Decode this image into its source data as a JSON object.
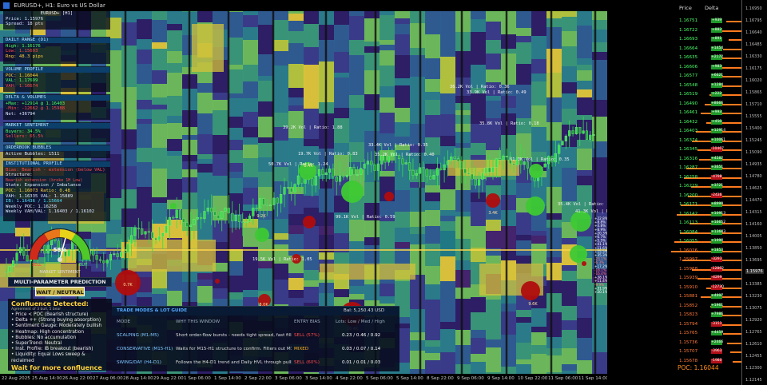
{
  "window_title": "EURUSD+, H1: Euro vs US Dollar",
  "symbol_panel": {
    "title": "EURUSD+ [H1]",
    "price": "Price: 1.15976",
    "spread": "Spread: 18 pts"
  },
  "daily_range": {
    "header": "DAILY RANGE (D1)",
    "high": "High: 1.16176",
    "low": "Low:  1.15693",
    "range": "Rng:  48.3 pips"
  },
  "volume_profile": {
    "header": "VOLUME PROFILE",
    "poc": "POC: 1.16044",
    "val": "VAL: 1.17699",
    "vah": "VAH: 1.16674"
  },
  "delta": {
    "header": "DELTA & VOLUMES",
    "max": "+Max: +12914 @ 1.16403",
    "min": "-Min: -12662 @ 1.15988",
    "net": "Net:  +36794"
  },
  "sentiment": {
    "header": "MARKET SENTIMENT",
    "buyers": "Buyers: 34.5%",
    "sellers": "Sellers: 65.5%"
  },
  "bubbles": {
    "header": "ORDERBOOK BUBBLES",
    "active": "Active Bubbles: 1511"
  },
  "institutional": {
    "header": "INSTITUTIONAL PROFILE",
    "bias": "Bias: Bearish - extension (below VAL)",
    "structure": "Structure:",
    "structure_detail": "Bearish extension (broke 1H Low)",
    "state": "State: Expansion / Imbalance",
    "poc_ratio": "POC: 1.16073  Ratio: 0.48",
    "vah_val": "VAH: 1.16335  VAL: 1.15889",
    "ib": "IB: 1.16436 / 1.15664",
    "weekly": "Weekly POC: 1.16258",
    "weekly_range": "Weekly VAH/VAL: 1.16403 / 1.16102"
  },
  "gauge": {
    "value": "58%",
    "sell_label": "SELL",
    "buy_label": "BUY",
    "title": "MARKET SENTIMENT",
    "needle_fraction": 0.58
  },
  "prediction": {
    "title": "MULTI-PARAMETER PREDICTION",
    "result": "WAIT / NEUTRAL"
  },
  "confluence": {
    "title": "Confluence Detected:",
    "subtitle": "Agreement of 3 bull, 5 bear",
    "items": [
      "• Price < POC (Bearish structure)",
      "• Delta ++ (Strong buying absorption)",
      "• Sentiment Gauge: Moderately bullish",
      "• Heatmap: High concentration",
      "• Bubbles: No accumulation",
      "• SuperTrend: Neutral",
      "• Inst. Profile: IB breakout (bearish)",
      "• Liquidity: Equal Lows sweep & reclaimed"
    ],
    "footer": "Wait for more confluence"
  },
  "modes": {
    "title": "TRADE MODES & LOT GUIDE",
    "balance": "Bal: 5,250.43 USD",
    "headers": [
      "MODE",
      "WHY THIS WINDOW",
      "ENTRY BIAS",
      "Lots: Low / Med / High"
    ],
    "rows": [
      {
        "mode": "SCALPING (M1-M5)",
        "why": "Short order-flow bursts - needs tight spread, fast fills.",
        "bias": "SELL (57%)",
        "bias_color": "#ff4a4a",
        "lots": "0.23 / 0.46 / 0.92"
      },
      {
        "mode": "CONSERVATIVE (M15-H1)",
        "why": "Waits for M15-H1 structure to confirm. Filters out M1 noise.",
        "bias": "MIXED",
        "bias_color": "#ffb020",
        "lots": "0.03 / 0.07 / 0.14"
      },
      {
        "mode": "SWING/DAY (H4-D1)",
        "why": "Follows the H4-D1 trend and Daily HVL through pullbacks.",
        "bias": "SELL (60%)",
        "bias_color": "#ff4a4a",
        "lots": "0.01 / 0.01 / 0.03"
      }
    ]
  },
  "annotations": [
    "36.2K Vol | Ratio: 0.36",
    "33.9K Vol | Ratio: 0.49",
    "39.2K Vol | Ratio: 1.88",
    "33.4K Vol | Ratio: 0.35",
    "35.8K Vol | Ratio: 0.18",
    "19.7K Vol | Ratio: 0.83",
    "50.7K Vol | Ratio: 1.24",
    "35.2K Vol | Ratio: 0.40",
    "61.0K Vol | Ratio: 0.35",
    "19.5K Vol | Ratio: 1.05",
    "35.4K Vol | Ratio: 0.51",
    "41.3K Vol | Ratio: 0.48",
    "99.1K Vol | Ratio: 0.59"
  ],
  "bubble_labels": [
    "0.7K",
    "9.2K",
    "8.4K",
    "3.4K",
    "9.6K",
    "8.0K",
    "16.4K"
  ],
  "ladder": {
    "price_header": "Price",
    "delta_header": "Delta",
    "prices": [
      "1.16751",
      "1.16722",
      "1.16693",
      "1.16664",
      "1.16635",
      "1.16606",
      "1.16577",
      "1.16548",
      "1.16519",
      "1.16490",
      "1.16461",
      "1.16432",
      "1.16403",
      "1.16374",
      "1.16345",
      "1.16316",
      "1.16287",
      "1.16258",
      "1.16229",
      "1.16200",
      "1.16171",
      "1.16142",
      "1.16113",
      "1.16084",
      "1.16055",
      "1.16026",
      "1.15997",
      "1.15968",
      "1.15939",
      "1.15910",
      "1.15881",
      "1.15852",
      "1.15823",
      "1.15794",
      "1.15765",
      "1.15736",
      "1.15707",
      "1.15678"
    ],
    "deltas": [
      "+939",
      "+882",
      "+891",
      "+1454",
      "+2172",
      "+983",
      "+6621",
      "+1284",
      "+222",
      "+8666",
      "+993",
      "+456",
      "+12914",
      "+10061",
      "-10467",
      "+4582",
      "+3651",
      "-4798",
      "+3721",
      "-2436",
      "+8999",
      "+10913",
      "+16652",
      "+13683",
      "+1990",
      "+1853",
      "-3293",
      "-12862",
      "-4299",
      "-12730",
      "+4997",
      "+1961",
      "+7986",
      "-3151",
      "+4459",
      "+2466",
      "-3963",
      "-1980"
    ],
    "bars": [
      0.22,
      0.3,
      0.18,
      0.26,
      0.34,
      0.38,
      0.42,
      0.28,
      0.46,
      0.52,
      0.58,
      0.5,
      0.65,
      0.7,
      0.62,
      0.6,
      0.78,
      0.82,
      0.72,
      0.76,
      0.86,
      0.92,
      0.74,
      0.88,
      0.96,
      1.0,
      0.84,
      0.7,
      0.62,
      0.5,
      0.58,
      0.44,
      0.36,
      0.3,
      0.26,
      0.2,
      0.16,
      0.12
    ],
    "poc_label": "POC: 1.16044"
  },
  "price_axis": [
    "1.16950",
    "1.16795",
    "1.16640",
    "1.16485",
    "1.16330",
    "1.16175",
    "1.16020",
    "1.15865",
    "1.15710",
    "1.15555",
    "1.15400",
    "1.15245",
    "1.15090",
    "1.14935",
    "1.14780",
    "1.14625",
    "1.14470",
    "1.14315",
    "1.14160",
    "1.14005",
    "1.13850",
    "1.13695",
    "1.13540",
    "1.13385",
    "1.13230",
    "1.13075",
    "1.12920",
    "1.12765",
    "1.12610",
    "1.12455",
    "1.12300",
    "1.12145"
  ],
  "current_price": "1.15976",
  "time_axis": [
    "22 Aug 2025",
    "25 Aug 14:00",
    "26 Aug 22:00",
    "27 Aug 06:00",
    "28 Aug 14:00",
    "29 Aug 22:00",
    "1 Sep 06:00",
    "1 Sep 14:00",
    "2 Sep 22:00",
    "3 Sep 06:00",
    "3 Sep 14:00",
    "4 Sep 22:00",
    "5 Sep 06:00",
    "5 Sep 14:00",
    "8 Sep 22:00",
    "9 Sep 06:00",
    "9 Sep 14:00",
    "10 Sep 22:00",
    "11 Sep 06:00",
    "11 Sep 14:00"
  ],
  "colors": {
    "buy_bubble": "#3ec934",
    "sell_bubble": "#b00d0d",
    "candle": "#33e04a",
    "poc_line": "#ffd84a",
    "ladder_bar": "#ff7a1f"
  }
}
